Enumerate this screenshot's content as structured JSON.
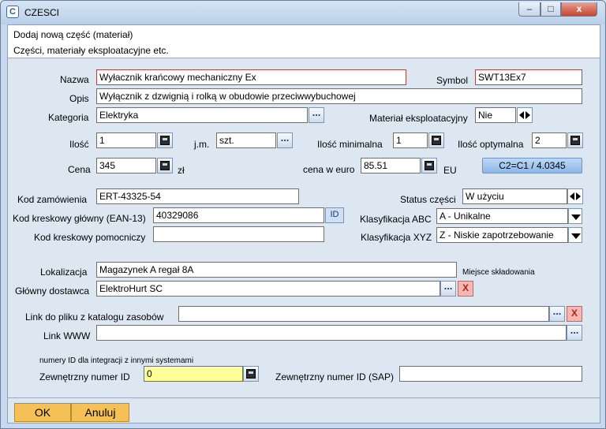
{
  "window": {
    "title": "CZESCI",
    "app_icon_glyph": "C",
    "controls": {
      "minimize": "–",
      "maximize": "□",
      "close": "x"
    }
  },
  "header": {
    "title": "Dodaj nową część (materiał)",
    "subtitle": "Części, materiały eksploatacyjne etc."
  },
  "form": {
    "nazwa": {
      "label": "Nazwa",
      "value": "Wyłacznik krańcowy mechaniczny Ex"
    },
    "symbol": {
      "label": "Symbol",
      "value": "SWT13Ex7"
    },
    "opis": {
      "label": "Opis",
      "value": "Wyłącznik z dzwignią i rolką w obudowie przeciwwybuchowej"
    },
    "kategoria": {
      "label": "Kategoria",
      "value": "Elektryka"
    },
    "material_eksploatacyjny": {
      "label": "Materiał eksploatacyjny",
      "value": "Nie"
    },
    "ilosc": {
      "label": "Ilość",
      "value": "1"
    },
    "jm": {
      "label": "j.m.",
      "value": "szt."
    },
    "ilosc_minimalna": {
      "label": "Ilość minimalna",
      "value": "1"
    },
    "ilosc_optymalna": {
      "label": "Ilość optymalna",
      "value": "2"
    },
    "cena": {
      "label": "Cena",
      "value": "345",
      "unit": "zł"
    },
    "cena_euro": {
      "label": "cena w euro",
      "value": "85.51",
      "unit": "EU"
    },
    "convert_button": "C2=C1 / 4.0345",
    "kod_zamowienia": {
      "label": "Kod zamówienia",
      "value": "ERT-43325-54"
    },
    "status": {
      "label": "Status części",
      "value": "W użyciu"
    },
    "ean13": {
      "label": "Kod kreskowy główny (EAN-13)",
      "value": "40329086",
      "button": "ID"
    },
    "klasyfikacja_abc": {
      "label": "Klasyfikacja ABC",
      "value": "A - Unikalne"
    },
    "kod_pomocniczy": {
      "label": "Kod kreskowy pomocniczy",
      "value": ""
    },
    "klasyfikacja_xyz": {
      "label": "Klasyfikacja XYZ",
      "value": "Z - Niskie zapotrzebowanie"
    },
    "lokalizacja": {
      "label": "Lokalizacja",
      "value": "Magazynek A  regał 8A",
      "hint": "Miejsce składowania"
    },
    "dostawca": {
      "label": "Główny dostawca",
      "value": "ElektroHurt SC"
    },
    "link_katalog": {
      "label": "Link do pliku z katalogu zasobów",
      "value": ""
    },
    "link_www": {
      "label": "Link WWW",
      "value": ""
    },
    "integration_note": "numery ID dla integracji z innymi systemami",
    "zewn_id": {
      "label": "Zewnętrzny numer ID",
      "value": "0"
    },
    "zewn_sap": {
      "label": "Zewnętrzny numer ID (SAP)",
      "value": ""
    },
    "dots": "...",
    "x": "X"
  },
  "footer": {
    "ok": "OK",
    "cancel": "Anuluj"
  }
}
